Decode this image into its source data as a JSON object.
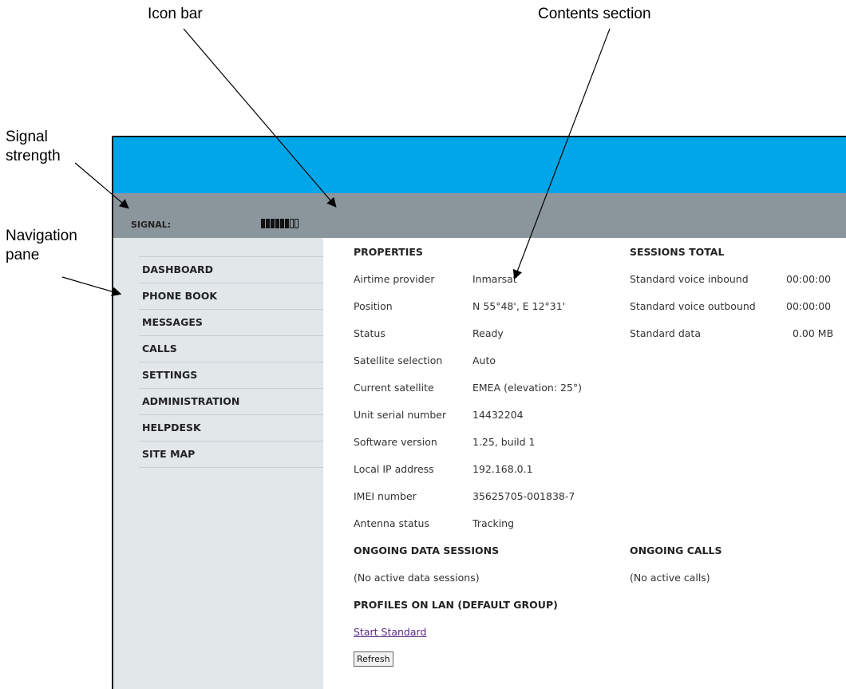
{
  "annotations": {
    "icon_bar": "Icon bar",
    "contents_section": "Contents section",
    "signal_strength_line1": "Signal",
    "signal_strength_line2": "strength",
    "navigation_pane_line1": "Navigation",
    "navigation_pane_line2": "pane"
  },
  "iconbar": {
    "signal_label": "SIGNAL:",
    "signal_level": {
      "filled": 6,
      "total": 8
    }
  },
  "nav": {
    "items": [
      {
        "label": "DASHBOARD"
      },
      {
        "label": "PHONE BOOK"
      },
      {
        "label": "MESSAGES"
      },
      {
        "label": "CALLS"
      },
      {
        "label": "SETTINGS"
      },
      {
        "label": "ADMINISTRATION"
      },
      {
        "label": "HELPDESK"
      },
      {
        "label": "SITE MAP"
      }
    ]
  },
  "properties": {
    "heading": "PROPERTIES",
    "rows": [
      {
        "label": "Airtime provider",
        "value": "Inmarsat"
      },
      {
        "label": "Position",
        "value": "N 55°48', E 12°31'"
      },
      {
        "label": "Status",
        "value": "Ready"
      },
      {
        "label": "Satellite selection",
        "value": "Auto"
      },
      {
        "label": "Current satellite",
        "value": "EMEA (elevation: 25°)"
      },
      {
        "label": "Unit serial number",
        "value": "14432204"
      },
      {
        "label": "Software version",
        "value": "1.25, build 1"
      },
      {
        "label": "Local IP address",
        "value": "192.168.0.1"
      },
      {
        "label": "IMEI number",
        "value": "35625705-001838-7"
      },
      {
        "label": "Antenna status",
        "value": "Tracking"
      }
    ]
  },
  "sessions_total": {
    "heading": "SESSIONS TOTAL",
    "rows": [
      {
        "label": "Standard voice inbound",
        "value": "00:00:00"
      },
      {
        "label": "Standard voice outbound",
        "value": "00:00:00"
      },
      {
        "label": "Standard data",
        "value": "0.00 MB"
      }
    ]
  },
  "ongoing_data": {
    "heading": "ONGOING DATA SESSIONS",
    "text": "(No active data sessions)"
  },
  "ongoing_calls": {
    "heading": "ONGOING CALLS",
    "text": "(No active calls)"
  },
  "profiles": {
    "heading": "PROFILES ON LAN (DEFAULT GROUP)",
    "link": "Start Standard",
    "refresh_label": "Refresh"
  },
  "colors": {
    "topbar": "#00a6e8",
    "iconbar": "#8b969c",
    "nav_bg": "#e2e7ea",
    "link": "#5b2a86"
  }
}
